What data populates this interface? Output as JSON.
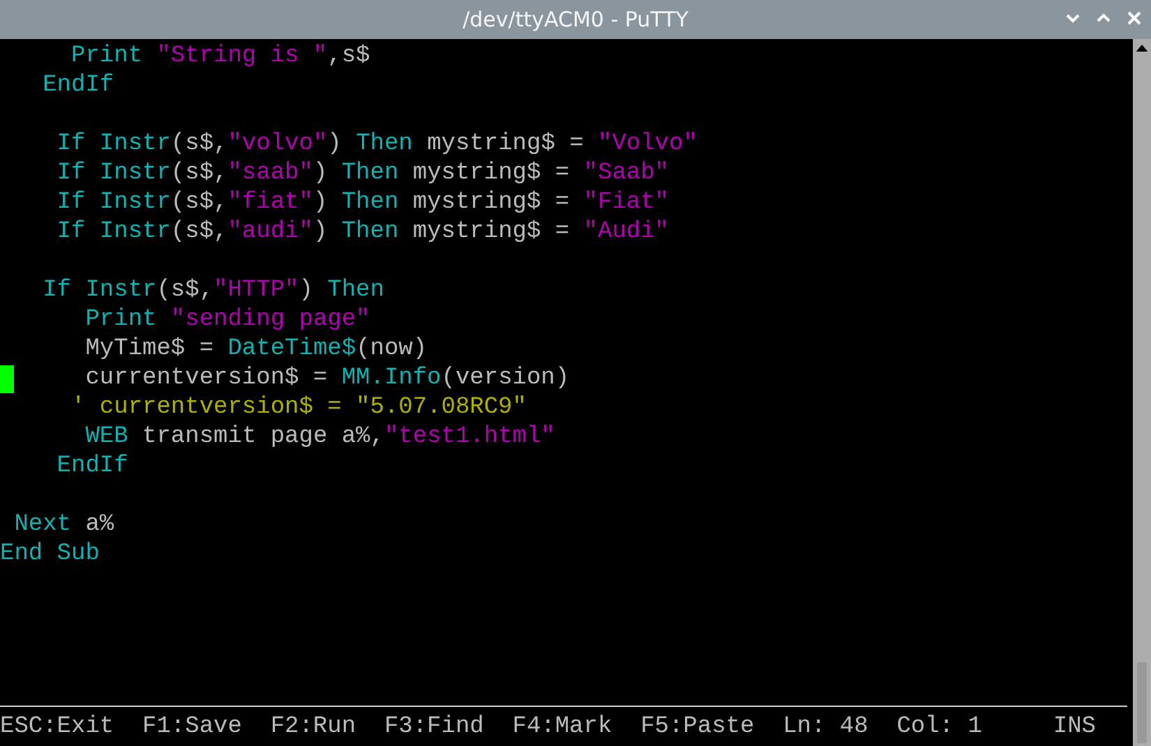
{
  "window": {
    "title": "/dev/ttyACM0 - PuTTY"
  },
  "lines": [
    {
      "kind": "code",
      "segments": [
        {
          "kind": "keyword",
          "text": "     Print "
        },
        {
          "kind": "string",
          "text": "\"String is \""
        },
        {
          "kind": "plain",
          "text": ",s$"
        }
      ]
    },
    {
      "kind": "code",
      "segments": [
        {
          "kind": "keyword",
          "text": "   EndIf"
        }
      ]
    },
    {
      "kind": "blank"
    },
    {
      "kind": "code",
      "segments": [
        {
          "kind": "keyword",
          "text": "    If Instr"
        },
        {
          "kind": "plain",
          "text": "(s$,"
        },
        {
          "kind": "string",
          "text": "\"volvo\""
        },
        {
          "kind": "plain",
          "text": ") "
        },
        {
          "kind": "keyword",
          "text": "Then"
        },
        {
          "kind": "plain",
          "text": " mystring$ = "
        },
        {
          "kind": "string",
          "text": "\"Volvo\""
        }
      ]
    },
    {
      "kind": "code",
      "segments": [
        {
          "kind": "keyword",
          "text": "    If Instr"
        },
        {
          "kind": "plain",
          "text": "(s$,"
        },
        {
          "kind": "string",
          "text": "\"saab\""
        },
        {
          "kind": "plain",
          "text": ") "
        },
        {
          "kind": "keyword",
          "text": "Then"
        },
        {
          "kind": "plain",
          "text": " mystring$ = "
        },
        {
          "kind": "string",
          "text": "\"Saab\""
        }
      ]
    },
    {
      "kind": "code",
      "segments": [
        {
          "kind": "keyword",
          "text": "    If Instr"
        },
        {
          "kind": "plain",
          "text": "(s$,"
        },
        {
          "kind": "string",
          "text": "\"fiat\""
        },
        {
          "kind": "plain",
          "text": ") "
        },
        {
          "kind": "keyword",
          "text": "Then"
        },
        {
          "kind": "plain",
          "text": " mystring$ = "
        },
        {
          "kind": "string",
          "text": "\"Fiat\""
        }
      ]
    },
    {
      "kind": "code",
      "segments": [
        {
          "kind": "keyword",
          "text": "    If Instr"
        },
        {
          "kind": "plain",
          "text": "(s$,"
        },
        {
          "kind": "string",
          "text": "\"audi\""
        },
        {
          "kind": "plain",
          "text": ") "
        },
        {
          "kind": "keyword",
          "text": "Then"
        },
        {
          "kind": "plain",
          "text": " mystring$ = "
        },
        {
          "kind": "string",
          "text": "\"Audi\""
        }
      ]
    },
    {
      "kind": "blank"
    },
    {
      "kind": "code",
      "segments": [
        {
          "kind": "keyword",
          "text": "   If Instr"
        },
        {
          "kind": "plain",
          "text": "(s$,"
        },
        {
          "kind": "string",
          "text": "\"HTTP\""
        },
        {
          "kind": "plain",
          "text": ") "
        },
        {
          "kind": "keyword",
          "text": "Then"
        }
      ]
    },
    {
      "kind": "code",
      "segments": [
        {
          "kind": "keyword",
          "text": "      Print "
        },
        {
          "kind": "string",
          "text": "\"sending page\""
        }
      ]
    },
    {
      "kind": "code",
      "segments": [
        {
          "kind": "plain",
          "text": "      MyTime$ = "
        },
        {
          "kind": "keyword",
          "text": "DateTime$"
        },
        {
          "kind": "plain",
          "text": "(now)"
        }
      ]
    },
    {
      "kind": "code",
      "cursor": true,
      "segments": [
        {
          "kind": "plain",
          "text": "      currentversion$ = "
        },
        {
          "kind": "keyword",
          "text": "MM.Info"
        },
        {
          "kind": "plain",
          "text": "(version)"
        }
      ]
    },
    {
      "kind": "code",
      "segments": [
        {
          "kind": "comment",
          "text": "     ' currentversion$ = \"5.07.08RC9\""
        }
      ]
    },
    {
      "kind": "code",
      "segments": [
        {
          "kind": "keyword",
          "text": "      WEB"
        },
        {
          "kind": "plain",
          "text": " transmit page a%,"
        },
        {
          "kind": "string",
          "text": "\"test1.html\""
        }
      ]
    },
    {
      "kind": "code",
      "segments": [
        {
          "kind": "keyword",
          "text": "    EndIf"
        }
      ]
    },
    {
      "kind": "blank"
    },
    {
      "kind": "code",
      "segments": [
        {
          "kind": "keyword",
          "text": " Next"
        },
        {
          "kind": "plain",
          "text": " a%"
        }
      ]
    },
    {
      "kind": "code",
      "segments": [
        {
          "kind": "keyword",
          "text": "End Sub"
        }
      ]
    }
  ],
  "status_bar": [
    "ESC:Exit",
    "F1:Save",
    "F2:Run",
    "F3:Find",
    "F4:Mark",
    "F5:Paste",
    "Ln: 48",
    "Col: 1",
    "INS"
  ]
}
